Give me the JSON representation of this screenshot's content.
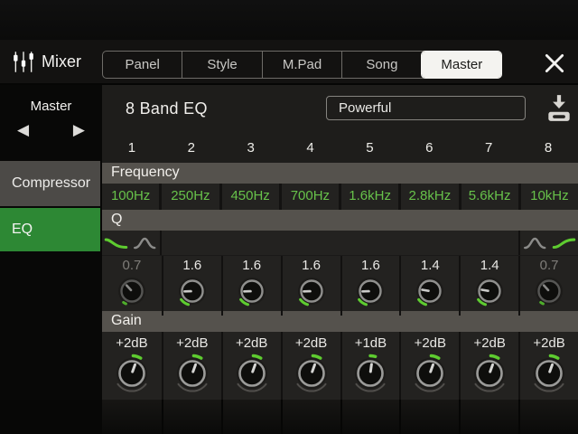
{
  "header": {
    "app_title": "Mixer",
    "tabs": [
      {
        "label": "Panel",
        "active": false
      },
      {
        "label": "Style",
        "active": false
      },
      {
        "label": "M.Pad",
        "active": false
      },
      {
        "label": "Song",
        "active": false
      },
      {
        "label": "Master",
        "active": true
      }
    ]
  },
  "sidebar": {
    "selector_label": "Master",
    "prev_icon": "◀",
    "next_icon": "▶",
    "items": [
      {
        "label": "Compressor",
        "active": false
      },
      {
        "label": "EQ",
        "active": true
      }
    ]
  },
  "main": {
    "title": "8 Band EQ",
    "preset_value": "Powerful",
    "channels": [
      "1",
      "2",
      "3",
      "4",
      "5",
      "6",
      "7",
      "8"
    ],
    "frequency": {
      "label": "Frequency",
      "values": [
        "100Hz",
        "250Hz",
        "450Hz",
        "700Hz",
        "1.6kHz",
        "2.8kHz",
        "5.6kHz",
        "10kHz"
      ]
    },
    "q": {
      "label": "Q",
      "values": [
        "0.7",
        "1.6",
        "1.6",
        "1.6",
        "1.6",
        "1.4",
        "1.4",
        "0.7"
      ],
      "disabled": [
        true,
        false,
        false,
        false,
        false,
        false,
        false,
        true
      ],
      "band1_filter_types": [
        {
          "name": "shelf-down",
          "selected": true
        },
        {
          "name": "peak",
          "selected": false
        }
      ],
      "band8_filter_types": [
        {
          "name": "peak",
          "selected": false
        },
        {
          "name": "shelf-up",
          "selected": true
        }
      ]
    },
    "gain": {
      "label": "Gain",
      "values": [
        "+2dB",
        "+2dB",
        "+2dB",
        "+2dB",
        "+1dB",
        "+2dB",
        "+2dB",
        "+2dB"
      ]
    }
  },
  "icons": {
    "app": "mixer-faders",
    "close": "close-x",
    "save": "save-to-disk"
  },
  "colors": {
    "sidebar_active_green": "#2d8834",
    "value_green": "#67c24a",
    "knob_green": "#5ecc30",
    "section_bar": "#55524d"
  }
}
